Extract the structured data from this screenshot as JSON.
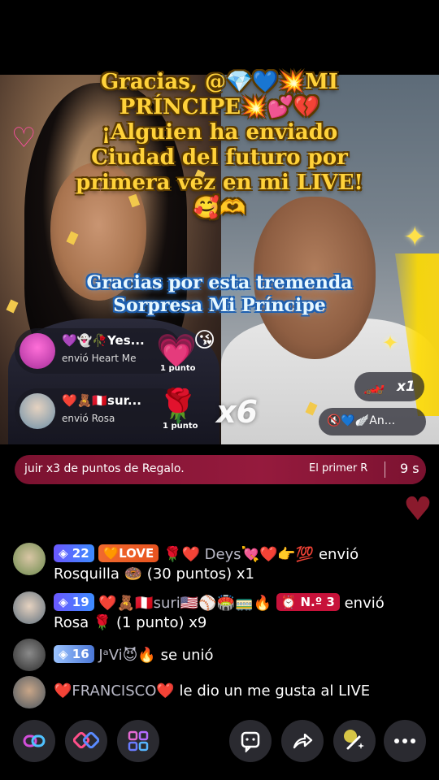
{
  "banner": {
    "line1": "Gracias, @💎💙💥MI",
    "line2": "PRÍNCIPE💥💕💔",
    "line3": "¡Alguien ha enviado",
    "line4": "Ciudad del futuro por",
    "line5": "primera vez en mi LIVE!",
    "line6": "🥰🫶"
  },
  "thanks_line1": "Gracias por esta tremenda",
  "thanks_line2": "Sorpresa Mi Príncipe",
  "gifts": [
    {
      "name": "💜👻🥀Yes...",
      "action": "envió Heart Me",
      "points": "1 punto",
      "icon": "💗"
    },
    {
      "name": "❤️🧸🇵🇪sur...",
      "action": "envió Rosa",
      "points": "1 punto",
      "icon": "🌹"
    }
  ],
  "combo": "x6",
  "side": {
    "car_count": "x1",
    "car_icon": "🏎️",
    "preview_text": "🔇💙🪽An..."
  },
  "promo": {
    "text": "juir x3 de puntos de Regalo.",
    "rank": "El primer R",
    "timer": "9 s"
  },
  "chat": [
    {
      "level": "22",
      "love_badge": "LOVE",
      "name": "🌹❤️ Deys💘❤️👉💯",
      "action": "envió",
      "line2": "Rosquilla 🍩 (30 puntos) x1"
    },
    {
      "level": "19",
      "name": "❤️🧸🇵🇪suri🇺🇸⚾🏟️🚃🔥",
      "num_badge": "N.º 3",
      "action": "envió",
      "line2_name": "Rosa",
      "line2": "🌹 (1 punto) x9"
    },
    {
      "level": "16",
      "name": "JᵃVi😈🔥",
      "action": "se unió"
    },
    {
      "name": "❤️FRANCISCO❤️",
      "action": "le dio un me gusta al LIVE"
    }
  ],
  "toolbar": {
    "icons": [
      "link-icon",
      "multi-guest-icon",
      "apps-grid-icon",
      "comment-icon",
      "share-icon",
      "magic-wand-icon",
      "more-icon"
    ]
  },
  "colors": {
    "banner_gold": "#ffd23a",
    "promo_bg": "#951a3d",
    "level_badge": "#5a6bff",
    "love_badge": "#e8531f"
  }
}
